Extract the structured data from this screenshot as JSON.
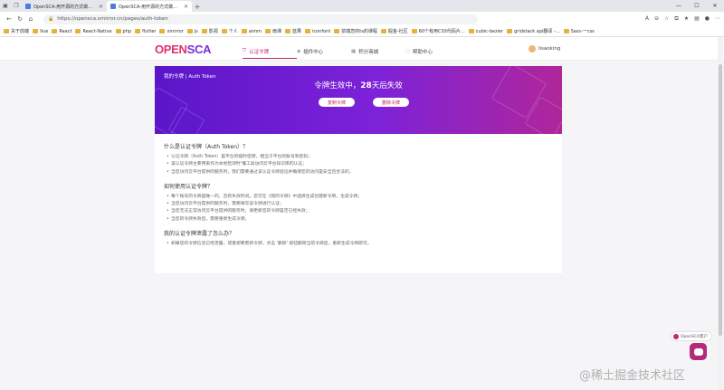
{
  "browser": {
    "tabs": [
      {
        "title": "OpenSCA-用开源的方式做开源",
        "active": false
      },
      {
        "title": "OpenSCA-用开源的方式做开源",
        "active": true
      }
    ],
    "url": "https://opensca.xmirror.cn/pages/auth-token",
    "bookmarks": [
      "关于前端",
      "Vue",
      "React",
      "React-Native",
      "php",
      "flutter",
      "xmirror",
      "js",
      "影视",
      "个人",
      "aimm",
      "雨课",
      "蓝果",
      "iconfont",
      "前端您的ts的课程",
      "掘金-社区",
      "60个有用CSS代码片...",
      "cubic-bezier",
      "gridstack api翻译 -...",
      "Sass-一css"
    ]
  },
  "site": {
    "logo_part1": "OPEN",
    "logo_part2": "SCA",
    "nav": [
      {
        "label": "认证令牌",
        "icon": "shield-icon",
        "active": true
      },
      {
        "label": "插件中心",
        "icon": "plugin-icon",
        "active": false
      },
      {
        "label": "积分商城",
        "icon": "gift-icon",
        "active": false
      },
      {
        "label": "帮助中心",
        "icon": "help-icon",
        "active": false
      }
    ],
    "username": "lisaoking"
  },
  "banner": {
    "label": "我的令牌 | Auth Token",
    "status_prefix": "令牌生效中，",
    "days": "28",
    "status_suffix": "天后失效",
    "copy_button": "复制令牌",
    "delete_button": "删除令牌"
  },
  "faq": [
    {
      "question": "什么是认证令牌（Auth Token）？",
      "items": [
        "认证令牌（Auth Token）是平台的临时密钥，相当于平台的账号和密码；",
        "该认证令牌主要用来作为本地检测时'懂工具访问云平台知识库的认证；",
        "当您访问云平台提供的服务时，我们需要通过该认证令牌验证并确保您的访问是安全且合法的。"
      ]
    },
    {
      "question": "如何使用认证令牌？",
      "items": [
        "每个账号的令牌是唯一的，且有失效时间。您可在《我的令牌》中选择生成创建新令牌，生成令牌；",
        "当您访问云平台提供的服务时，需要填写该令牌进行认证；",
        "当您无法正常访问云平台提供的服务时，请更新您的令牌是否已经失效；",
        "当您的令牌失效后，需要重新生成令牌。"
      ]
    },
    {
      "question": "我的认证令牌泄露了怎么办？",
      "items": [
        "如果您的令牌信息已经泄露，或者想要更新令牌，点击 '删除' 按钮删除当前令牌后，重新生成令牌即可。"
      ]
    }
  ],
  "widgets": {
    "chat_tag": "OpenSCA客户",
    "watermark": "@稀土掘金技术社区"
  },
  "colors": {
    "brand_pink": "#c3286b",
    "brand_purple": "#7b2fd6",
    "banner_start": "#5b16c9",
    "banner_end": "#b0269a"
  }
}
